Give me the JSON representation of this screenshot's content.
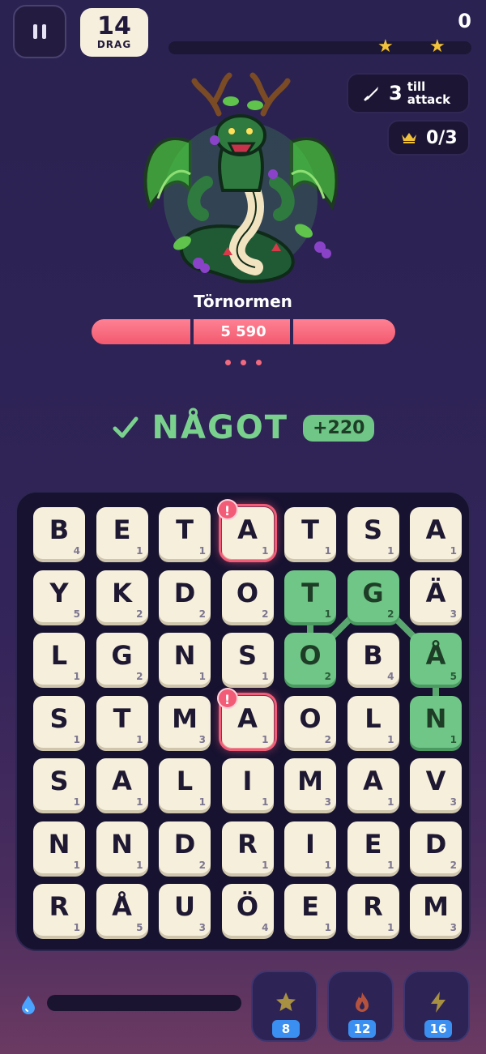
{
  "top": {
    "moves": "14",
    "moves_label": "DRAG",
    "score": "0",
    "stars_shown": 2
  },
  "attack": {
    "count": "3",
    "label_line1": "till",
    "label_line2": "attack"
  },
  "crowns": {
    "value": "0/3"
  },
  "boss": {
    "name": "Törnormen",
    "hp": "5 590",
    "hp_fraction": 1.0
  },
  "found": {
    "word": "NÅGOT",
    "points": "+220"
  },
  "colors": {
    "selected": "#6fc686",
    "alert": "#f25c77",
    "tile": "#f6efdc",
    "hp": "#f2596f"
  },
  "board": {
    "rows": [
      [
        {
          "l": "B",
          "p": "4"
        },
        {
          "l": "E",
          "p": "1"
        },
        {
          "l": "T",
          "p": "1"
        },
        {
          "l": "A",
          "p": "1",
          "alert": true
        },
        {
          "l": "T",
          "p": "1"
        },
        {
          "l": "S",
          "p": "1"
        },
        {
          "l": "A",
          "p": "1"
        }
      ],
      [
        {
          "l": "Y",
          "p": "5"
        },
        {
          "l": "K",
          "p": "2"
        },
        {
          "l": "D",
          "p": "2"
        },
        {
          "l": "O",
          "p": "2"
        },
        {
          "l": "T",
          "p": "1",
          "sel": true
        },
        {
          "l": "G",
          "p": "2",
          "sel": true
        },
        {
          "l": "Ä",
          "p": "3"
        }
      ],
      [
        {
          "l": "L",
          "p": "1"
        },
        {
          "l": "G",
          "p": "2"
        },
        {
          "l": "N",
          "p": "1"
        },
        {
          "l": "S",
          "p": "1"
        },
        {
          "l": "O",
          "p": "2",
          "sel": true
        },
        {
          "l": "B",
          "p": "4"
        },
        {
          "l": "Å",
          "p": "5",
          "sel": true
        }
      ],
      [
        {
          "l": "S",
          "p": "1"
        },
        {
          "l": "T",
          "p": "1"
        },
        {
          "l": "M",
          "p": "3"
        },
        {
          "l": "A",
          "p": "1",
          "alert": true
        },
        {
          "l": "O",
          "p": "2"
        },
        {
          "l": "L",
          "p": "1"
        },
        {
          "l": "N",
          "p": "1",
          "sel": true
        }
      ],
      [
        {
          "l": "S",
          "p": "1"
        },
        {
          "l": "A",
          "p": "1"
        },
        {
          "l": "L",
          "p": "1"
        },
        {
          "l": "I",
          "p": "1"
        },
        {
          "l": "M",
          "p": "3"
        },
        {
          "l": "A",
          "p": "1"
        },
        {
          "l": "V",
          "p": "3"
        }
      ],
      [
        {
          "l": "N",
          "p": "1"
        },
        {
          "l": "N",
          "p": "1"
        },
        {
          "l": "D",
          "p": "2"
        },
        {
          "l": "R",
          "p": "1"
        },
        {
          "l": "I",
          "p": "1"
        },
        {
          "l": "E",
          "p": "1"
        },
        {
          "l": "D",
          "p": "2"
        }
      ],
      [
        {
          "l": "R",
          "p": "1"
        },
        {
          "l": "Å",
          "p": "5"
        },
        {
          "l": "U",
          "p": "3"
        },
        {
          "l": "Ö",
          "p": "4"
        },
        {
          "l": "E",
          "p": "1"
        },
        {
          "l": "R",
          "p": "1"
        },
        {
          "l": "M",
          "p": "3"
        }
      ]
    ],
    "alert_glyph": "!",
    "path": [
      [
        3,
        6
      ],
      [
        2,
        6
      ],
      [
        1,
        5
      ],
      [
        2,
        4
      ],
      [
        1,
        4
      ]
    ]
  },
  "powerups": [
    {
      "icon": "star-icon",
      "count": "8"
    },
    {
      "icon": "flame-icon",
      "count": "12"
    },
    {
      "icon": "lightning-icon",
      "count": "16"
    }
  ],
  "mana_fraction": 0.0
}
